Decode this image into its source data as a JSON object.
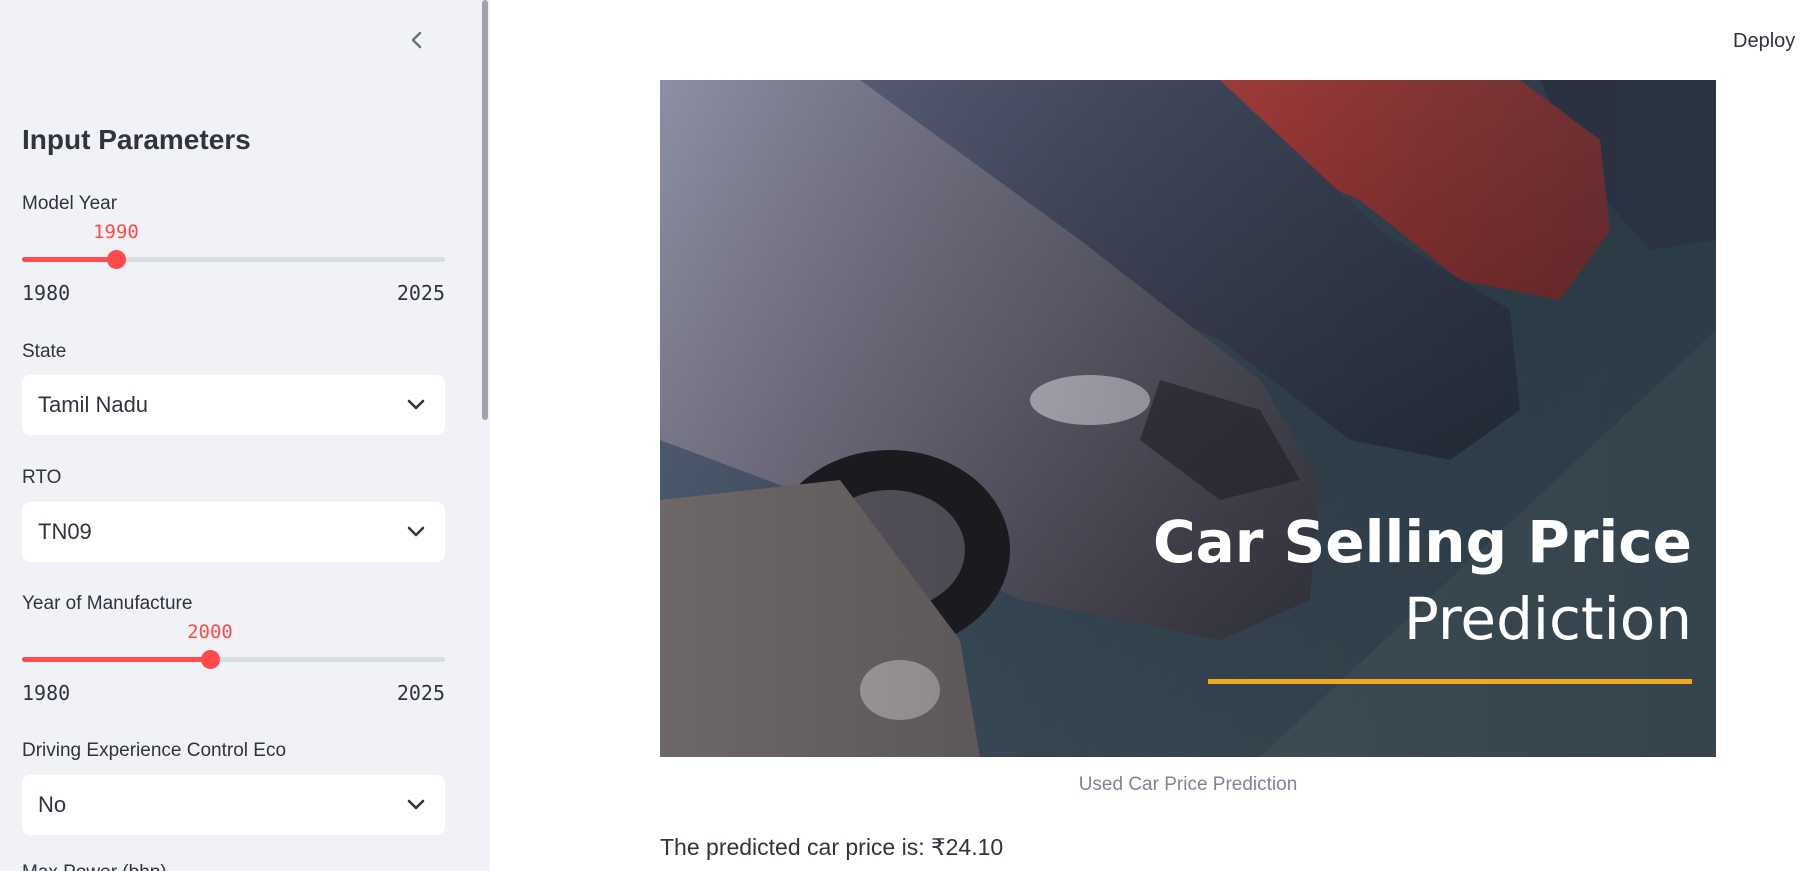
{
  "header": {
    "deploy_label": "Deploy"
  },
  "sidebar": {
    "title": "Input Parameters",
    "model_year": {
      "label": "Model Year",
      "value": 1990,
      "value_text": "1990",
      "min": 1980,
      "max": 2025,
      "min_text": "1980",
      "max_text": "2025"
    },
    "state": {
      "label": "State",
      "value": "Tamil Nadu"
    },
    "rto": {
      "label": "RTO",
      "value": "TN09"
    },
    "year_of_manufacture": {
      "label": "Year of Manufacture",
      "value": 2000,
      "value_text": "2000",
      "min": 1980,
      "max": 2025,
      "min_text": "1980",
      "max_text": "2025"
    },
    "driving_experience_control_eco": {
      "label": "Driving Experience Control Eco",
      "value": "No"
    },
    "next_label": "Max Power (bhp)"
  },
  "main": {
    "hero_image": {
      "title_line1": "Car Selling Price",
      "title_line2": "Prediction"
    },
    "caption": "Used Car Price Prediction",
    "result_text": "The predicted car price is: ₹24.10"
  },
  "colors": {
    "accent": "#ff4b4b",
    "sidebar_bg": "#f0f2f6",
    "text": "#31333f",
    "caption": "#808495",
    "hero_underline": "#f2a91e"
  }
}
